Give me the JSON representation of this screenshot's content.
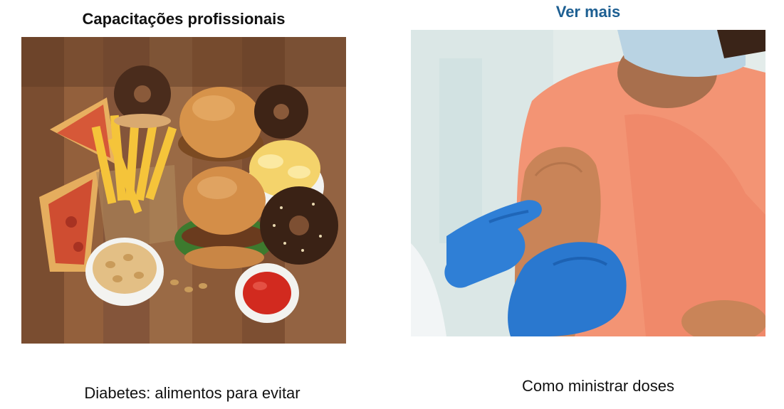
{
  "section": {
    "title": "Capacitações profissionais",
    "see_more_label": "Ver mais",
    "accent_color": "#1d5f92"
  },
  "cards": [
    {
      "image_icon": "fast-food-photo",
      "caption": "Diabetes: alimentos para evitar"
    },
    {
      "image_icon": "vaccination-photo",
      "caption": "Como ministrar doses"
    }
  ]
}
